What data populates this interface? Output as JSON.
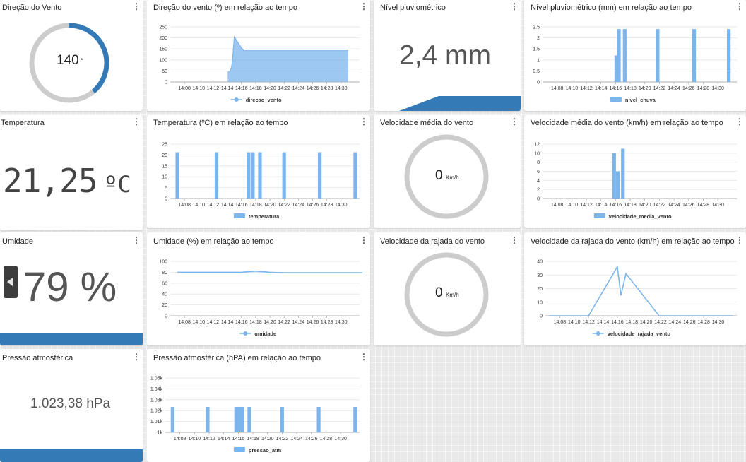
{
  "colors": {
    "accent": "#337ab7",
    "series": "#7cb5ec",
    "ring": "#cccccc"
  },
  "wind_direction": {
    "title": "Direção do Vento",
    "value": "140",
    "unit": "°",
    "gauge_value": 140,
    "gauge_max": 360
  },
  "wind_direction_chart": {
    "title": "Direção do vento (º) em relação ao tempo"
  },
  "rain_level": {
    "title": "Nível pluviométrico",
    "value": "2,4 mm"
  },
  "rain_level_chart": {
    "title": "Nível pluviométrico (mm) em relação ao tempo"
  },
  "temperature": {
    "title": "Temperatura",
    "value": "21,25",
    "unit": "ºC"
  },
  "temperature_chart": {
    "title": "Temperatura (ºC) em relação ao tempo"
  },
  "wind_speed": {
    "title": "Velocidade média do vento",
    "value": "0",
    "unit": "Km/h"
  },
  "wind_speed_chart": {
    "title": "Velocidade média do vento (km/h) em relação ao tempo"
  },
  "humidity": {
    "title": "Umidade",
    "value": "79 %"
  },
  "humidity_chart": {
    "title": "Umidade (%) em relação ao tempo"
  },
  "wind_gust": {
    "title": "Velocidade da rajada do vento",
    "value": "0",
    "unit": "Km/h"
  },
  "wind_gust_chart": {
    "title": "Velocidade da rajada do vento (km/h) em relação ao tempo"
  },
  "pressure": {
    "title": "Pressão atmosférica",
    "value": "1.023,38 hPa"
  },
  "pressure_chart": {
    "title": "Pressão atmosférica (hPA) em relação ao tempo"
  },
  "chart_data": [
    {
      "id": "direcao",
      "type": "area",
      "x_ticks": [
        "14:08",
        "14:10",
        "14:12",
        "14:14",
        "14:16",
        "14:18",
        "14:20",
        "14:22",
        "14:24",
        "14:26",
        "14:28",
        "14:30"
      ],
      "y_ticks": [
        "0",
        "50",
        "100",
        "150",
        "200",
        "250"
      ],
      "ylim": [
        0,
        250
      ],
      "points": [
        [
          14.07,
          45
        ],
        [
          14.25,
          45
        ],
        [
          14.33,
          45
        ],
        [
          14.42,
          52
        ],
        [
          14.5,
          60
        ],
        [
          14.6,
          65
        ],
        [
          14.75,
          100
        ],
        [
          15.0,
          205
        ],
        [
          15.5,
          180
        ],
        [
          16.0,
          155
        ],
        [
          16.35,
          142
        ],
        [
          16.5,
          142
        ],
        [
          17.0,
          142
        ],
        [
          18.0,
          142
        ],
        [
          19.0,
          142
        ],
        [
          20.0,
          142
        ],
        [
          21.0,
          142
        ],
        [
          22.0,
          142
        ],
        [
          23.0,
          142
        ],
        [
          24.0,
          142
        ],
        [
          25.0,
          142
        ],
        [
          26.0,
          142
        ],
        [
          27.0,
          142
        ],
        [
          28.0,
          142
        ],
        [
          29.0,
          142
        ],
        [
          30.0,
          142
        ],
        [
          31.0,
          142
        ]
      ],
      "x_points": [
        14.07,
        14.25,
        14.33,
        14.42,
        14.5,
        14.6,
        14.75,
        15.0,
        15.5,
        16.0,
        16.35,
        16.5,
        17.0,
        18.0,
        19.0,
        20.0,
        21.0,
        22.0,
        23.0,
        24.0,
        25.0,
        26.0,
        27.0,
        28.0,
        29.0,
        30.0,
        31.0
      ],
      "series": [
        {
          "name": "direcao_vento"
        }
      ]
    },
    {
      "id": "chuva",
      "type": "bar",
      "x_ticks": [
        "14:08",
        "14:10",
        "14:12",
        "14:14",
        "14:16",
        "14:18",
        "14:20",
        "14:22",
        "14:24",
        "14:26",
        "14:28",
        "14:30"
      ],
      "y_ticks": [
        "0",
        "0.5",
        "1",
        "1.5",
        "2",
        "2.5"
      ],
      "ylim": [
        0,
        2.5
      ],
      "bars": [
        [
          16.1,
          1.2
        ],
        [
          16.45,
          2.4
        ],
        [
          17.25,
          2.4
        ],
        [
          21.75,
          2.4
        ],
        [
          26.75,
          2.4
        ],
        [
          31.5,
          2.4
        ]
      ],
      "series": [
        {
          "name": "nivel_chuva"
        }
      ]
    },
    {
      "id": "temperatura",
      "type": "bar",
      "x_ticks": [
        "14:08",
        "14:10",
        "14:12",
        "14:14",
        "14:16",
        "14:18",
        "14:20",
        "14:22",
        "14:24",
        "14:26",
        "14:28",
        "14:30"
      ],
      "y_ticks": [
        "0",
        "5",
        "10",
        "15",
        "20",
        "25"
      ],
      "ylim": [
        0,
        25
      ],
      "bars": [
        [
          7.0,
          21.25
        ],
        [
          12.5,
          21.25
        ],
        [
          17.0,
          21.25
        ],
        [
          17.6,
          21.25
        ],
        [
          18.6,
          21.25
        ],
        [
          22.0,
          21.25
        ],
        [
          27.0,
          21.25
        ],
        [
          32.0,
          21.25
        ]
      ],
      "series": [
        {
          "name": "temperatura"
        }
      ]
    },
    {
      "id": "velocidade_media",
      "type": "bar",
      "x_ticks": [
        "14:08",
        "14:10",
        "14:12",
        "14:14",
        "14:16",
        "14:18",
        "14:20",
        "14:22",
        "14:24",
        "14:26",
        "14:28",
        "14:30"
      ],
      "y_ticks": [
        "0",
        "2",
        "4",
        "6",
        "8",
        "10",
        "12"
      ],
      "ylim": [
        0,
        12
      ],
      "bars": [
        [
          15.8,
          10
        ],
        [
          16.3,
          6
        ],
        [
          17.0,
          11
        ]
      ],
      "series": [
        {
          "name": "velocidade_media_vento"
        }
      ]
    },
    {
      "id": "umidade",
      "type": "line",
      "x_ticks": [
        "14:08",
        "14:10",
        "14:12",
        "14:14",
        "14:16",
        "14:18",
        "14:20",
        "14:22",
        "14:24",
        "14:26",
        "14:28",
        "14:30"
      ],
      "y_ticks": [
        "0",
        "20",
        "40",
        "60",
        "80",
        "100"
      ],
      "ylim": [
        0,
        100
      ],
      "points": [
        [
          7,
          80
        ],
        [
          10,
          80
        ],
        [
          13,
          80
        ],
        [
          16,
          80
        ],
        [
          18,
          82
        ],
        [
          20,
          80
        ],
        [
          22,
          79
        ],
        [
          26,
          79
        ],
        [
          30,
          79
        ],
        [
          33,
          79
        ]
      ],
      "x_points": [
        7,
        10,
        13,
        16,
        18,
        20,
        22,
        26,
        30,
        33
      ],
      "series": [
        {
          "name": "umidade"
        }
      ]
    },
    {
      "id": "rajada",
      "type": "line",
      "x_ticks": [
        "14:08",
        "14:10",
        "14:12",
        "14:14",
        "14:16",
        "14:18",
        "14:20",
        "14:22",
        "14:24",
        "14:26",
        "14:28",
        "14:30"
      ],
      "y_ticks": [
        "0",
        "10",
        "20",
        "30",
        "40"
      ],
      "ylim": [
        0,
        40
      ],
      "points": [
        [
          6.5,
          0
        ],
        [
          12.0,
          0
        ],
        [
          16.0,
          36
        ],
        [
          16.5,
          15
        ],
        [
          17.2,
          31
        ],
        [
          21.8,
          0
        ],
        [
          32.0,
          0
        ]
      ],
      "x_points": [
        6.5,
        12.0,
        16.0,
        16.5,
        17.2,
        21.8,
        32.0
      ],
      "series": [
        {
          "name": "velocidade_rajada_vento"
        }
      ]
    },
    {
      "id": "pressao",
      "type": "bar",
      "x_ticks": [
        "14:08",
        "14:10",
        "14:12",
        "14:14",
        "14:16",
        "14:18",
        "14:20",
        "14:22",
        "14:24",
        "14:26",
        "14:28",
        "14:30"
      ],
      "y_ticks": [
        "1k",
        "1.01k",
        "1.02k",
        "1.03k",
        "1.04k",
        "1.05k"
      ],
      "ylim": [
        1000,
        1050
      ],
      "bars": [
        [
          7.0,
          1023.4
        ],
        [
          11.8,
          1023.4
        ],
        [
          15.7,
          1023.4
        ],
        [
          16.1,
          1023.4
        ],
        [
          16.5,
          1023.4
        ],
        [
          17.5,
          1023.4
        ],
        [
          22.0,
          1023.4
        ],
        [
          27.0,
          1023.4
        ],
        [
          32.0,
          1023.4
        ]
      ],
      "series": [
        {
          "name": "pressao_atm"
        }
      ]
    }
  ]
}
